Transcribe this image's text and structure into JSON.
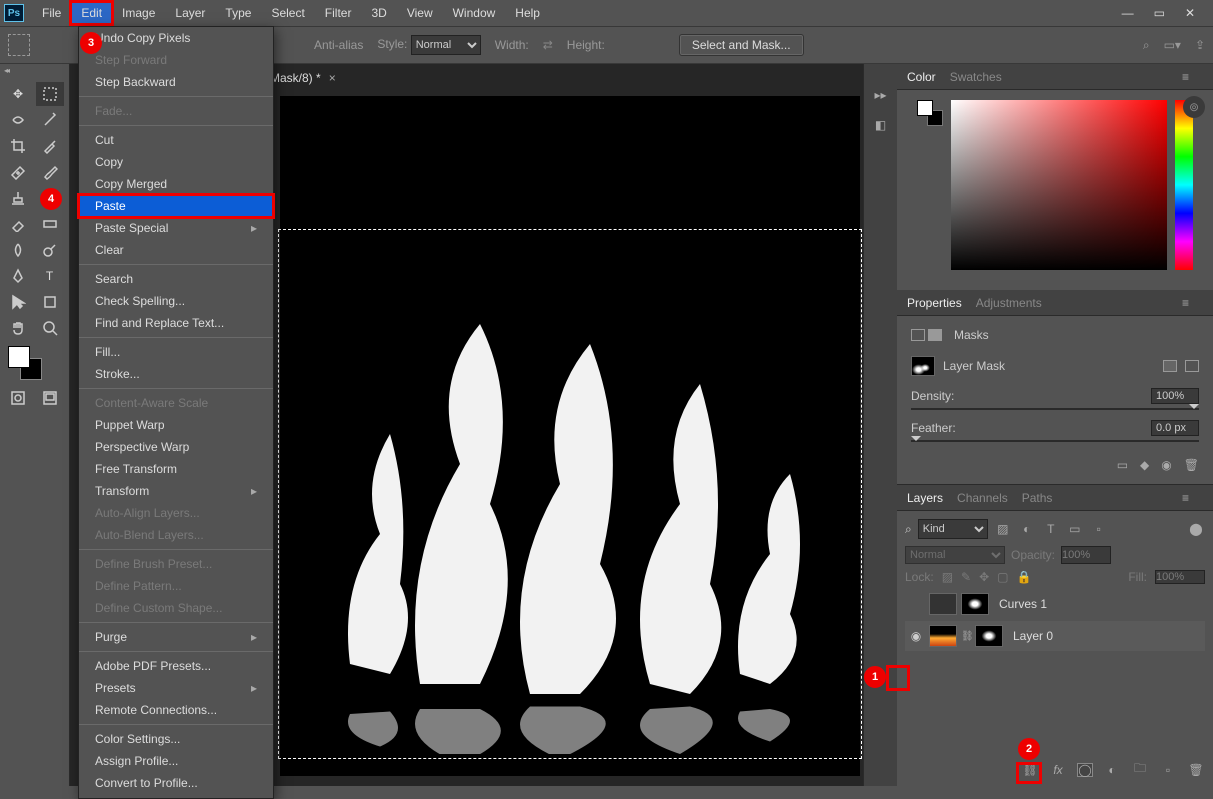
{
  "menubar": [
    "File",
    "Edit",
    "Image",
    "Layer",
    "Type",
    "Select",
    "Filter",
    "3D",
    "View",
    "Window",
    "Help"
  ],
  "options": {
    "antialias": "Anti-alias",
    "style_label": "Style:",
    "style_value": "Normal",
    "width_label": "Width:",
    "height_label": "Height:",
    "select_mask": "Select and Mask..."
  },
  "doctab": "Mask/8) *",
  "edit_menu": [
    {
      "t": "Undo Copy Pixels",
      "d": false
    },
    {
      "t": "Step Forward",
      "d": true
    },
    {
      "t": "Step Backward",
      "d": false
    },
    "-",
    {
      "t": "Fade...",
      "d": true
    },
    "-",
    {
      "t": "Cut",
      "d": false
    },
    {
      "t": "Copy",
      "d": false
    },
    {
      "t": "Copy Merged",
      "d": false
    },
    {
      "t": "Paste",
      "d": false,
      "paste": true
    },
    {
      "t": "Paste Special",
      "d": false,
      "arrow": true
    },
    {
      "t": "Clear",
      "d": false
    },
    "-",
    {
      "t": "Search",
      "d": false
    },
    {
      "t": "Check Spelling...",
      "d": false
    },
    {
      "t": "Find and Replace Text...",
      "d": false
    },
    "-",
    {
      "t": "Fill...",
      "d": false
    },
    {
      "t": "Stroke...",
      "d": false
    },
    "-",
    {
      "t": "Content-Aware Scale",
      "d": true
    },
    {
      "t": "Puppet Warp",
      "d": false
    },
    {
      "t": "Perspective Warp",
      "d": false
    },
    {
      "t": "Free Transform",
      "d": false
    },
    {
      "t": "Transform",
      "d": false,
      "arrow": true
    },
    {
      "t": "Auto-Align Layers...",
      "d": true
    },
    {
      "t": "Auto-Blend Layers...",
      "d": true
    },
    "-",
    {
      "t": "Define Brush Preset...",
      "d": true
    },
    {
      "t": "Define Pattern...",
      "d": true
    },
    {
      "t": "Define Custom Shape...",
      "d": true
    },
    "-",
    {
      "t": "Purge",
      "d": false,
      "arrow": true
    },
    "-",
    {
      "t": "Adobe PDF Presets...",
      "d": false
    },
    {
      "t": "Presets",
      "d": false,
      "arrow": true
    },
    {
      "t": "Remote Connections...",
      "d": false
    },
    "-",
    {
      "t": "Color Settings...",
      "d": false
    },
    {
      "t": "Assign Profile...",
      "d": false
    },
    {
      "t": "Convert to Profile...",
      "d": false
    }
  ],
  "panels": {
    "color": "Color",
    "swatches": "Swatches",
    "properties": "Properties",
    "adjustments": "Adjustments",
    "masks": "Masks",
    "layer_mask": "Layer Mask",
    "density": "Density:",
    "density_val": "100%",
    "feather": "Feather:",
    "feather_val": "0.0 px",
    "layers": "Layers",
    "channels": "Channels",
    "paths": "Paths",
    "kind": "Kind",
    "blend": "Normal",
    "opacity": "Opacity:",
    "opacity_val": "100%",
    "lock": "Lock:",
    "fill": "Fill:",
    "fill_val": "100%",
    "layer1": "Curves 1",
    "layer0": "Layer 0"
  },
  "annotations": {
    "n1": "1",
    "n2": "2",
    "n3": "3",
    "n4": "4"
  }
}
